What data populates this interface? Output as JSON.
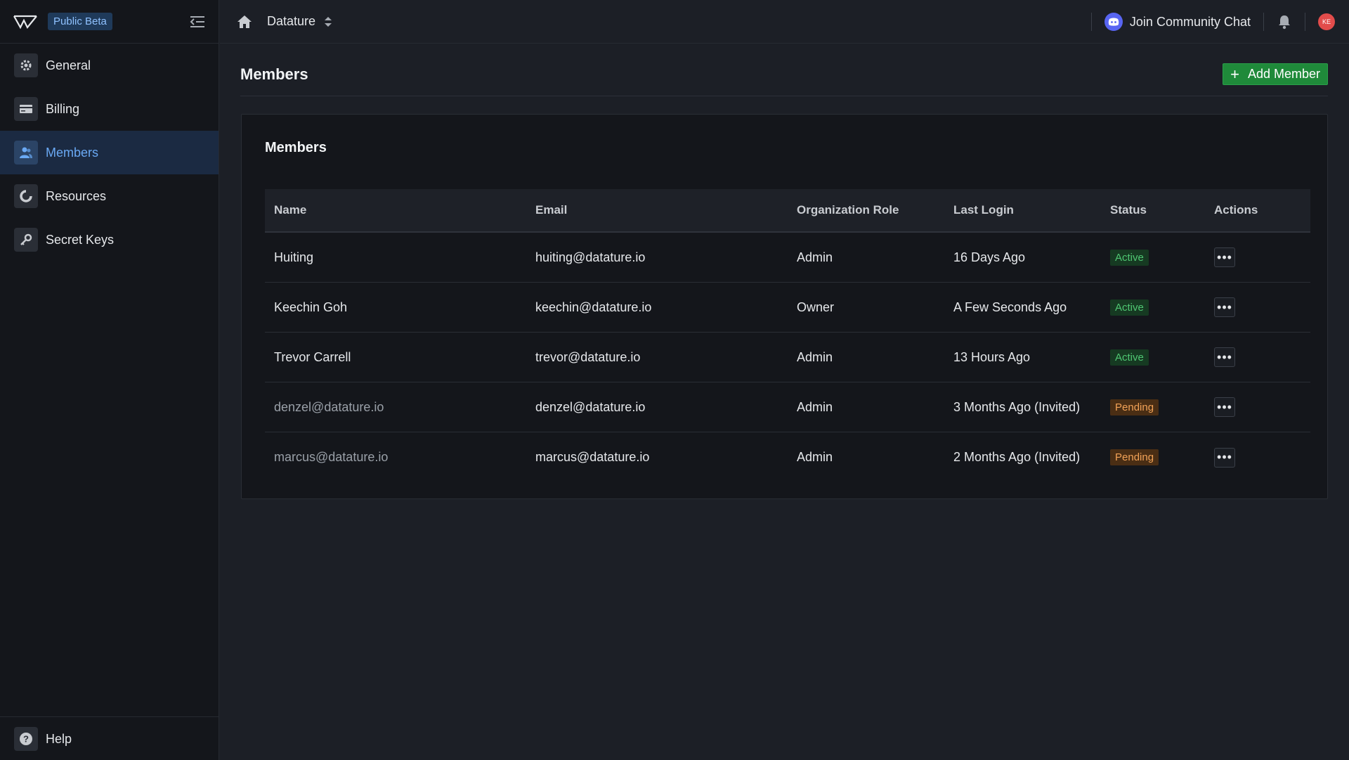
{
  "sidebar": {
    "beta_label": "Public Beta",
    "items": [
      {
        "label": "General",
        "icon": "gear-icon"
      },
      {
        "label": "Billing",
        "icon": "credit-card-icon"
      },
      {
        "label": "Members",
        "icon": "users-icon",
        "active": true
      },
      {
        "label": "Resources",
        "icon": "pie-chart-icon"
      },
      {
        "label": "Secret Keys",
        "icon": "key-icon"
      }
    ],
    "help_label": "Help"
  },
  "topbar": {
    "org_name": "Datature",
    "community_label": "Join Community Chat",
    "avatar_initials": "KE"
  },
  "page": {
    "title": "Members",
    "add_button_label": "Add Member",
    "card_title": "Members"
  },
  "table": {
    "columns": [
      "Name",
      "Email",
      "Organization Role",
      "Last Login",
      "Status",
      "Actions"
    ],
    "rows": [
      {
        "name": "Huiting",
        "email": "huiting@datature.io",
        "role": "Admin",
        "last_login": "16 Days Ago",
        "status": "Active"
      },
      {
        "name": "Keechin Goh",
        "email": "keechin@datature.io",
        "role": "Owner",
        "last_login": "A Few Seconds Ago",
        "status": "Active"
      },
      {
        "name": "Trevor Carrell",
        "email": "trevor@datature.io",
        "role": "Admin",
        "last_login": "13 Hours Ago",
        "status": "Active"
      },
      {
        "name": "denzel@datature.io",
        "email": "denzel@datature.io",
        "role": "Admin",
        "last_login": "3 Months Ago (Invited)",
        "status": "Pending"
      },
      {
        "name": "marcus@datature.io",
        "email": "marcus@datature.io",
        "role": "Admin",
        "last_login": "2 Months Ago (Invited)",
        "status": "Pending"
      }
    ]
  },
  "colors": {
    "accent_blue": "#6aa9f4",
    "add_green": "#1f8a3a",
    "active_green": "#4fc672",
    "pending_orange": "#f2a257",
    "discord": "#5865f2"
  }
}
